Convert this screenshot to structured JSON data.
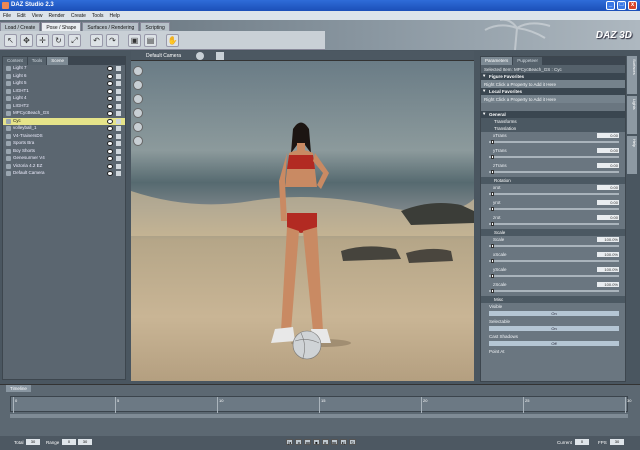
{
  "window": {
    "title": "DAZ Studio 2.3"
  },
  "menu": [
    "File",
    "Edit",
    "View",
    "Render",
    "Create",
    "Tools",
    "Help"
  ],
  "mode_tabs": [
    {
      "label": "Load / Create",
      "active": false
    },
    {
      "label": "Pose / Shape",
      "active": true
    },
    {
      "label": "Surfaces / Rendering",
      "active": false
    },
    {
      "label": "Scripting",
      "active": false
    }
  ],
  "brand": {
    "logo": "DAZ 3D"
  },
  "toolbar_icons": [
    "select-icon",
    "node-select-icon",
    "translate-icon",
    "rotate-icon",
    "scale-icon",
    "undo-icon",
    "redo-icon",
    "render-icon",
    "save-icon",
    "hand-icon"
  ],
  "left_panel": {
    "tabs": [
      "Content",
      "Tools",
      "Scene"
    ],
    "active_tab": "Scene",
    "tree": [
      {
        "label": "Light 7",
        "selected": false
      },
      {
        "label": "Light 6",
        "selected": false
      },
      {
        "label": "Light 5",
        "selected": false
      },
      {
        "label": "LIGHT1",
        "selected": false
      },
      {
        "label": "Light 4",
        "selected": false
      },
      {
        "label": "LIGHT2",
        "selected": false
      },
      {
        "label": "MPCycBeach_GS",
        "selected": false
      },
      {
        "label": "Cyc",
        "selected": true
      },
      {
        "label": "volleyball_1",
        "selected": false
      },
      {
        "label": "V4-TrainersDS",
        "selected": false
      },
      {
        "label": "Sports Bra",
        "selected": false
      },
      {
        "label": "Boy Shorts",
        "selected": false
      },
      {
        "label": "Genesurmer V4",
        "selected": false
      },
      {
        "label": "Victoria 4.2 EZ",
        "selected": false
      },
      {
        "label": "Default Camera",
        "selected": false
      }
    ]
  },
  "viewport": {
    "camera": "Default Camera"
  },
  "right_panel": {
    "tabs": [
      "Parameters",
      "Puppeteer"
    ],
    "active_tab": "Parameters",
    "selected_item_label": "Selected Item:",
    "selected_item": "MPCycBeach_GS : Cyc",
    "figure_favorites": "Figure Favorites",
    "local_favorites": "Local Favorites",
    "hint": "Right Click a Property to Add it Here",
    "general": "General",
    "transforms": "Transforms",
    "translation": "Translation",
    "rotation": "Rotation",
    "scale": "Scale",
    "misc": "Misc",
    "props": [
      {
        "label": "xTrans",
        "value": "0.00"
      },
      {
        "label": "yTrans",
        "value": "0.00"
      },
      {
        "label": "zTrans",
        "value": "0.00"
      },
      {
        "label": "xrot",
        "value": "0.00"
      },
      {
        "label": "yrot",
        "value": "0.00"
      },
      {
        "label": "zrot",
        "value": "0.00"
      },
      {
        "label": "Scale",
        "value": "100.0%"
      },
      {
        "label": "xScale",
        "value": "100.0%"
      },
      {
        "label": "yScale",
        "value": "100.0%"
      },
      {
        "label": "zScale",
        "value": "100.0%"
      }
    ],
    "visible": {
      "label": "Visible",
      "value": "On"
    },
    "selectable": {
      "label": "Selectable",
      "value": "On"
    },
    "cast_shadows": {
      "label": "Cast Shadows",
      "value": "Off"
    },
    "point_at": {
      "label": "Point At"
    }
  },
  "side_tabs": [
    "Surfaces",
    "Lights",
    "Help"
  ],
  "timeline": {
    "tab": "Timeline",
    "ticks": [
      "0",
      "5",
      "10",
      "15",
      "20",
      "25",
      "30"
    ]
  },
  "status": {
    "total_label": "Total",
    "range_label": "Range",
    "current_label": "Current",
    "fps_label": "FPS",
    "total": "30",
    "range_start": "0",
    "range_end": "30",
    "current": "0",
    "fps": "30"
  }
}
